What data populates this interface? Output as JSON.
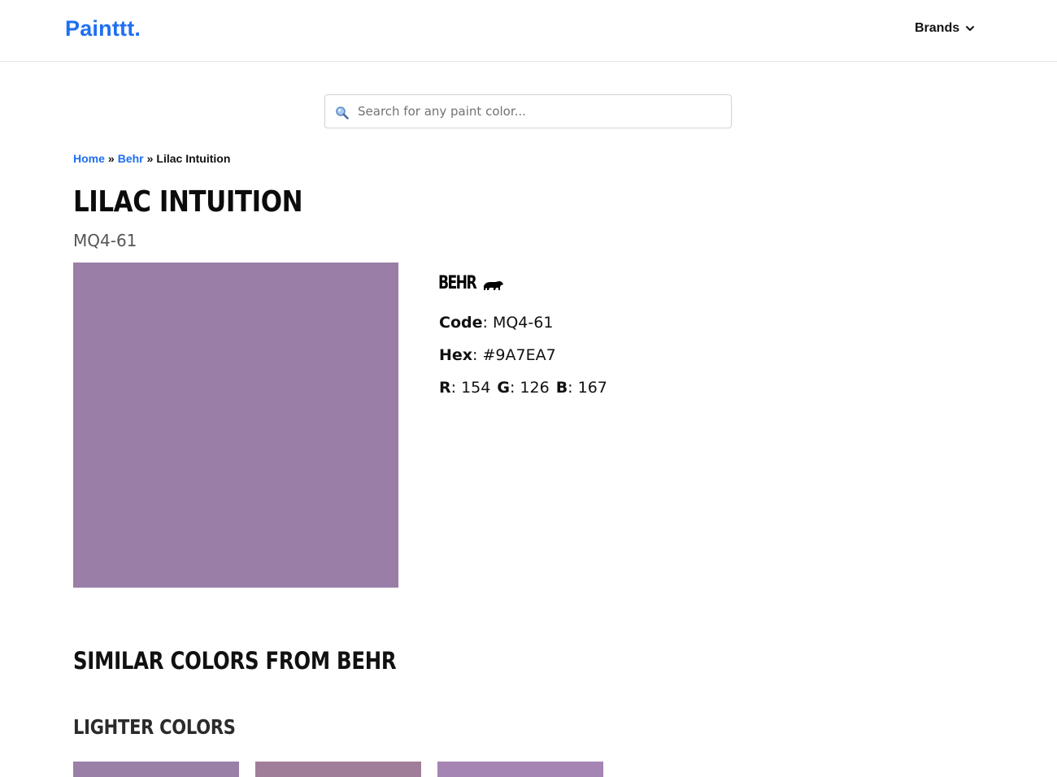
{
  "header": {
    "logo": "Painttt.",
    "brands_label": "Brands"
  },
  "search": {
    "placeholder": "Search for any paint color..."
  },
  "breadcrumb": {
    "home": "Home",
    "brand": "Behr",
    "current": "Lilac Intuition",
    "separator": "»"
  },
  "color": {
    "name": "LILAC INTUITION",
    "code": "MQ4-61",
    "hex": "#9A7EA7",
    "r": "154",
    "g": "126",
    "b": "167",
    "brand_logo_text": "BEHR"
  },
  "labels": {
    "code": "Code",
    "hex": "Hex",
    "r": "R",
    "g": "G",
    "b": "B",
    "colon": ": "
  },
  "sections": {
    "similar": "SIMILAR COLORS FROM BEHR",
    "lighter": "LIGHTER COLORS"
  },
  "lighter_colors": [
    {
      "hex": "#9A7FA6"
    },
    {
      "hex": "#A07E9A"
    },
    {
      "hex": "#A585B3"
    }
  ],
  "styles": {
    "accent": "#1F6FF0"
  }
}
